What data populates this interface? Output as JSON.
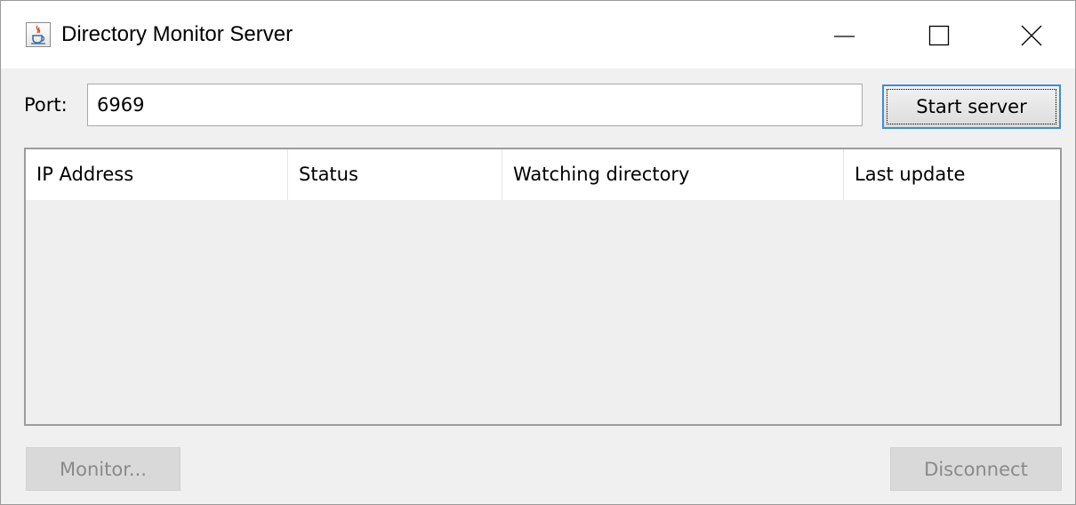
{
  "window": {
    "title": "Directory Monitor Server",
    "icon": "java-cup-icon",
    "controls": [
      "minimize-icon",
      "maximize-icon",
      "close-icon"
    ]
  },
  "port": {
    "label": "Port:",
    "value": "6969"
  },
  "start_button": {
    "label": "Start server"
  },
  "table": {
    "columns": [
      "IP Address",
      "Status",
      "Watching directory",
      "Last update"
    ],
    "rows": []
  },
  "footer": {
    "monitor_label": "Monitor...",
    "disconnect_label": "Disconnect"
  },
  "colors": {
    "focus_border": "#3c8ed8",
    "window_bg": "#f0f0f0",
    "disabled_text": "#8a8a8a"
  }
}
